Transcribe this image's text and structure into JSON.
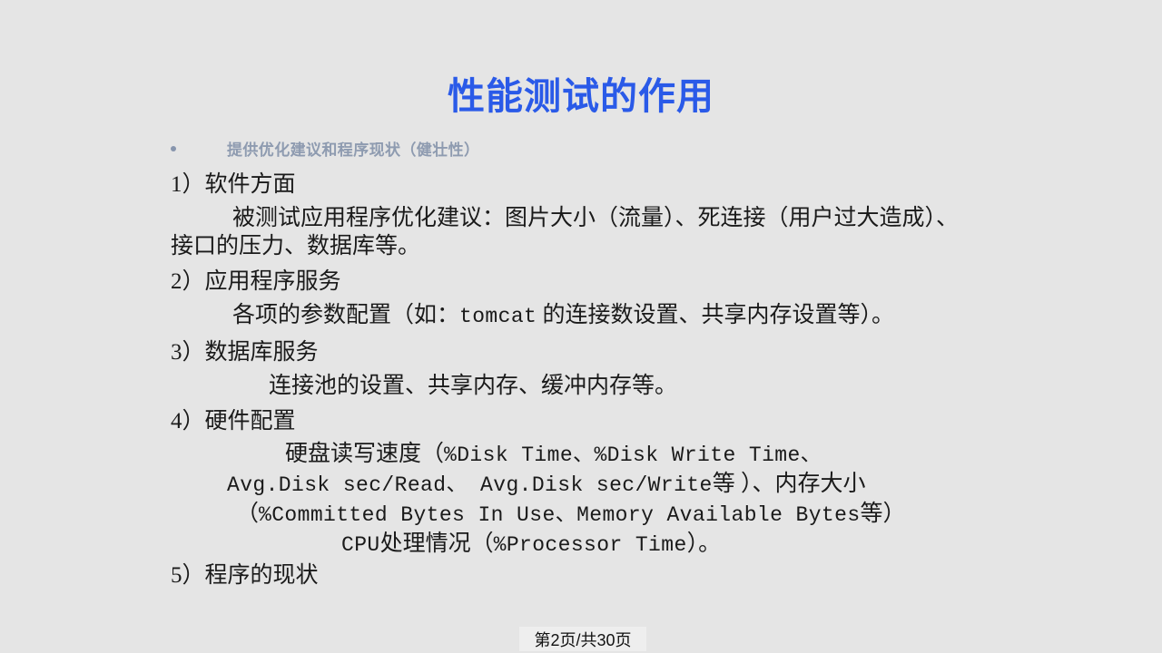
{
  "slide": {
    "title": "性能测试的作用",
    "title_color": "#2a5ae8",
    "background_color": "#e5e5e5",
    "bullet": {
      "marker": "bullet-dot",
      "text": "提供优化建议和程序现状（健壮性）",
      "color": "#8e9bb0"
    },
    "sections": [
      {
        "heading": "1）软件方面",
        "body": "被测试应用程序优化建议：图片大小（流量）、死连接（用户过大造成）、接口的压力、数据库等。"
      },
      {
        "heading": "2）应用程序服务",
        "body_pre": "各项的参数配置（如：",
        "body_mono": "tomcat",
        "body_post": " 的连接数设置、共享内存设置等）。"
      },
      {
        "heading": "3）数据库服务",
        "body": "连接池的设置、共享内存、缓冲内存等。"
      },
      {
        "heading": "4）硬件配置",
        "hw_line1_pre": "硬盘读写速度（",
        "hw_line1_mono": "%Disk Time、%Disk Write Time、",
        "hw_line2_mono": "Avg.Disk sec/Read、 Avg.Disk sec/Write",
        "hw_line2_post": "等 ）、内存大小",
        "hw_line3_pre": "（",
        "hw_line3_mono": "%Committed Bytes In Use、Memory Available Bytes",
        "hw_line3_post": "等）",
        "hw_line4_pre": "CPU",
        "hw_line4_mid": "处理情况（",
        "hw_line4_mono": "%Processor Time",
        "hw_line4_post": "）。"
      },
      {
        "heading": "5）程序的现状"
      }
    ],
    "page_indicator": "第2页/共30页"
  }
}
